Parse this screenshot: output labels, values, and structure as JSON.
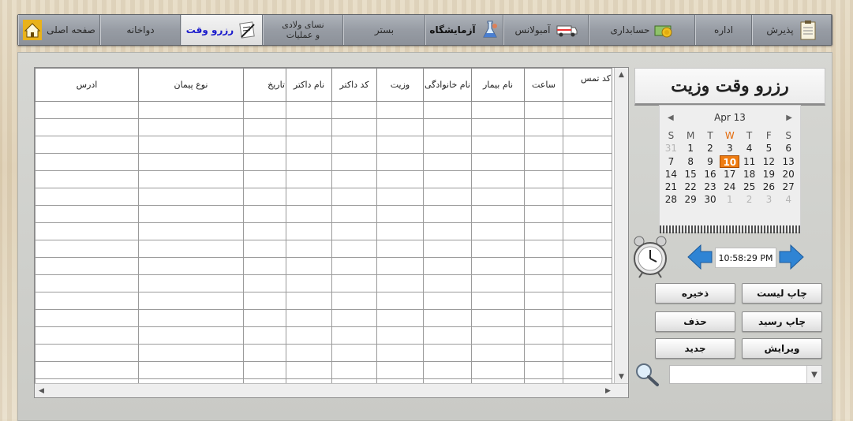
{
  "nav": {
    "tabs": [
      {
        "label": "پذیرش",
        "icon": "clipboard-icon"
      },
      {
        "label": "اداره",
        "icon": ""
      },
      {
        "label": "حسابداری",
        "icon": "money-icon"
      },
      {
        "label": "آمبولانس",
        "icon": "ambulance-icon"
      },
      {
        "label": "آزمایشگاه",
        "icon": "flask-icon"
      },
      {
        "label": "بستر",
        "icon": ""
      },
      {
        "label": "نسای ولادی\nو عملیات",
        "icon": ""
      },
      {
        "label": "رزرو وقت",
        "icon": "appointment-icon"
      },
      {
        "label": "دواخانه",
        "icon": ""
      },
      {
        "label": "صفحه اصلی",
        "icon": "home-icon"
      }
    ]
  },
  "form": {
    "title": "رزرو وقت وزیت"
  },
  "grid": {
    "columns": [
      "کد تمس",
      "ساعت",
      "نام بیمار",
      "نام خانوادگی",
      "وزیت",
      "کد داکتر",
      "نام داکتر",
      "تاریخ",
      "نوع پیمان",
      "ادرس"
    ]
  },
  "calendar": {
    "month_label": "Apr 13",
    "day_names": [
      "S",
      "M",
      "T",
      "W",
      "T",
      "F",
      "S"
    ],
    "weeks": [
      [
        "31",
        "1",
        "2",
        "3",
        "4",
        "5",
        "6"
      ],
      [
        "7",
        "8",
        "9",
        "10",
        "11",
        "12",
        "13"
      ],
      [
        "14",
        "15",
        "16",
        "17",
        "18",
        "19",
        "20"
      ],
      [
        "21",
        "22",
        "23",
        "24",
        "25",
        "26",
        "27"
      ],
      [
        "28",
        "29",
        "30",
        "1",
        "2",
        "3",
        "4"
      ]
    ],
    "selected_day": "10"
  },
  "clock": {
    "time": "10:58:29 PM"
  },
  "buttons": {
    "print_list": "چاپ لیست",
    "save": "ذخیره",
    "print_receipt": "چاپ رسید",
    "delete": "حذف",
    "edit": "ویرایش",
    "new": "جدید"
  },
  "search": {
    "value": ""
  },
  "colors": {
    "accent_orange": "#ef7c11",
    "active_tab_text": "#1a1acc",
    "arrow_blue": "#2f84d4"
  }
}
